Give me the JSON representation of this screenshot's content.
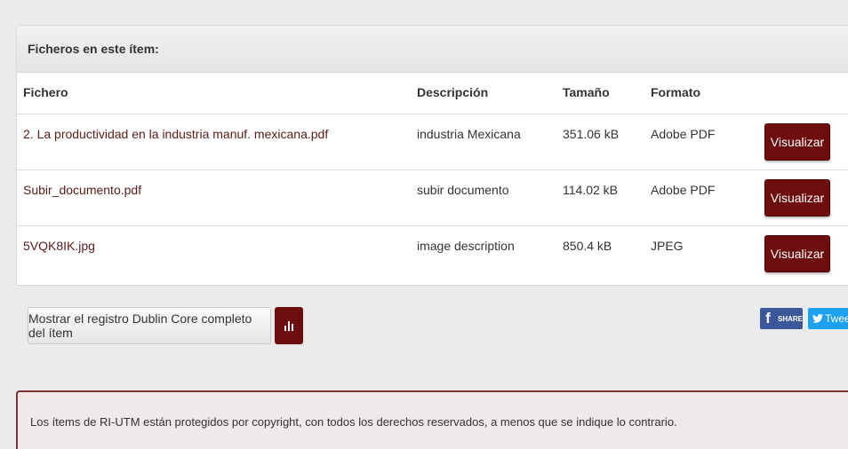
{
  "files_panel": {
    "heading": "Ficheros en este ítem:",
    "columns": {
      "file": "Fichero",
      "description": "Descripción",
      "size": "Tamaño",
      "format": "Formato"
    },
    "rows": [
      {
        "file": "2. La productividad en la industria manuf. mexicana.pdf",
        "description": "industria Mexicana",
        "size": "351.06 kB",
        "format": "Adobe PDF",
        "action": "Visualizar"
      },
      {
        "file": "Subir_documento.pdf",
        "description": "subir documento",
        "size": "114.02 kB",
        "format": "Adobe PDF",
        "action": "Visualizar"
      },
      {
        "file": "5VQK8IK.jpg",
        "description": "image description",
        "size": "850.4 kB",
        "format": "JPEG",
        "action": "Visualizar"
      }
    ]
  },
  "actions": {
    "dublin_core_button": "Mostrar el registro Dublin Core completo del ítem",
    "stats_icon": "bar-chart-icon"
  },
  "share": {
    "facebook_label": "SHARE",
    "twitter_label": "Tweet"
  },
  "notice": {
    "text": "Los ítems de RI-UTM están protegidos por copyright, con todos los derechos reservados, a menos que se indique lo contrario."
  },
  "colors": {
    "accent": "#6d0d0d",
    "facebook": "#3b5998",
    "twitter": "#1da1f2",
    "background": "#ebebeb"
  }
}
